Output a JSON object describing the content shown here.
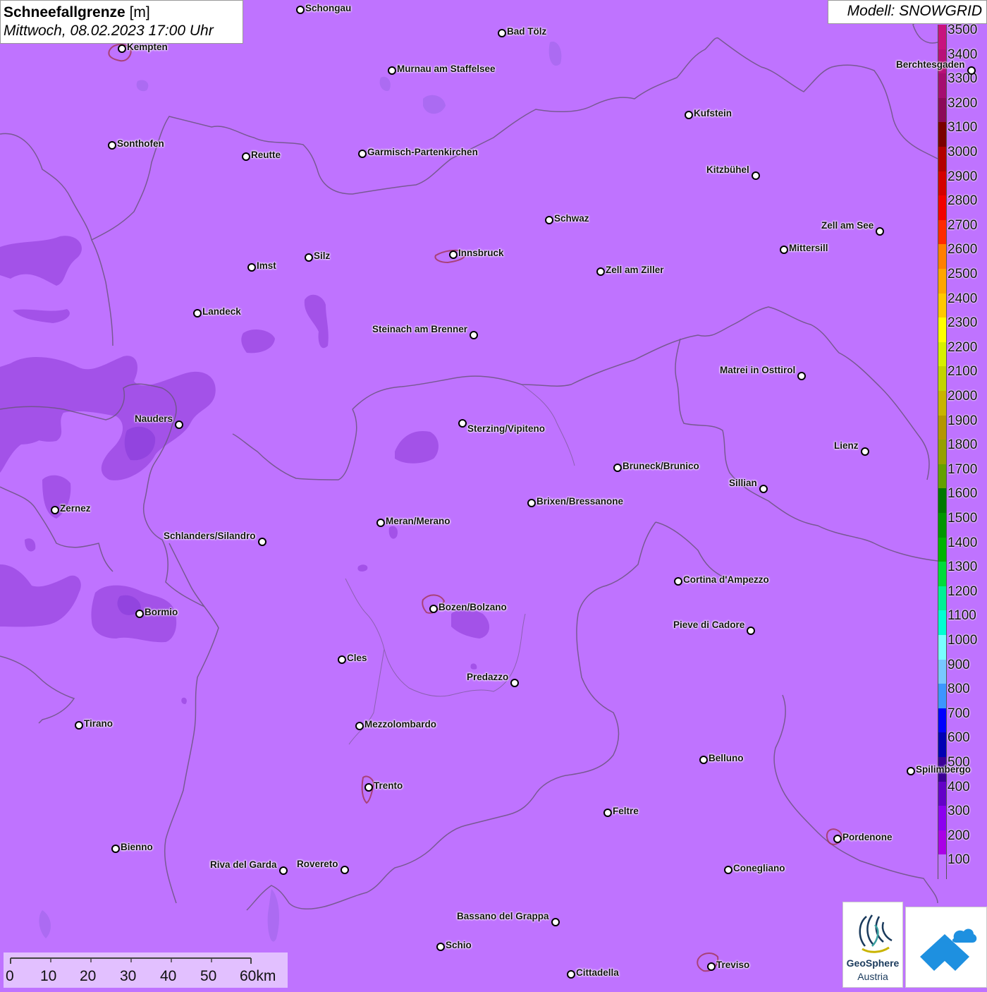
{
  "header": {
    "title_bold": "Schneefallgrenze",
    "title_unit": "[m]",
    "datetime": "Mittwoch, 08.02.2023 17:00 Uhr"
  },
  "model": {
    "label": "Modell: SNOWGRID"
  },
  "legend": {
    "unit": "m",
    "items": [
      {
        "label": "3500",
        "color": "#c8137e"
      },
      {
        "label": "3400",
        "color": "#b81078"
      },
      {
        "label": "3300",
        "color": "#a50d70"
      },
      {
        "label": "3200",
        "color": "#8c0a58"
      },
      {
        "label": "3100",
        "color": "#7a0000"
      },
      {
        "label": "3000",
        "color": "#b30000"
      },
      {
        "label": "2900",
        "color": "#d40000"
      },
      {
        "label": "2800",
        "color": "#f20000"
      },
      {
        "label": "2700",
        "color": "#ff2a00"
      },
      {
        "label": "2600",
        "color": "#ff7f00"
      },
      {
        "label": "2500",
        "color": "#ffa500"
      },
      {
        "label": "2400",
        "color": "#ffc800"
      },
      {
        "label": "2300",
        "color": "#ffff00"
      },
      {
        "label": "2200",
        "color": "#d6f000"
      },
      {
        "label": "2100",
        "color": "#c2d400"
      },
      {
        "label": "2000",
        "color": "#c8b400"
      },
      {
        "label": "1900",
        "color": "#b49600"
      },
      {
        "label": "1800",
        "color": "#96a000"
      },
      {
        "label": "1700",
        "color": "#64a000"
      },
      {
        "label": "1600",
        "color": "#007800"
      },
      {
        "label": "1500",
        "color": "#009600"
      },
      {
        "label": "1400",
        "color": "#00b400"
      },
      {
        "label": "1300",
        "color": "#00dc3c"
      },
      {
        "label": "1200",
        "color": "#00f096"
      },
      {
        "label": "1100",
        "color": "#00ffd2"
      },
      {
        "label": "1000",
        "color": "#78ffff"
      },
      {
        "label": "900",
        "color": "#78c8ff"
      },
      {
        "label": "800",
        "color": "#3c96ff"
      },
      {
        "label": "700",
        "color": "#0000ff"
      },
      {
        "label": "600",
        "color": "#0000b4"
      },
      {
        "label": "500",
        "color": "#3c0096"
      },
      {
        "label": "400",
        "color": "#6400c8"
      },
      {
        "label": "300",
        "color": "#8c00f0"
      },
      {
        "label": "200",
        "color": "#aa00e6"
      },
      {
        "label": "100",
        "color": "#bf73ff"
      }
    ]
  },
  "scale": {
    "labels": [
      "0",
      "10",
      "20",
      "30",
      "40",
      "50",
      "60km"
    ]
  },
  "logos": {
    "geosphere_line1": "GeoSphere",
    "geosphere_line2": "Austria"
  },
  "cities": [
    {
      "name": "Schongau"
    },
    {
      "name": "Bad Tölz"
    },
    {
      "name": "Kempten"
    },
    {
      "name": "Murnau am Staffelsee"
    },
    {
      "name": "Berchtesgaden"
    },
    {
      "name": "Kufstein"
    },
    {
      "name": "Sonthofen"
    },
    {
      "name": "Reutte"
    },
    {
      "name": "Garmisch-Partenkirchen"
    },
    {
      "name": "Kitzbühel"
    },
    {
      "name": "Schwaz"
    },
    {
      "name": "Zell am See"
    },
    {
      "name": "Innsbruck"
    },
    {
      "name": "Mittersill"
    },
    {
      "name": "Imst"
    },
    {
      "name": "Silz"
    },
    {
      "name": "Zell am Ziller"
    },
    {
      "name": "Landeck"
    },
    {
      "name": "Steinach am Brenner"
    },
    {
      "name": "Matrei in Osttirol"
    },
    {
      "name": "Nauders"
    },
    {
      "name": "Sterzing/Vipiteno"
    },
    {
      "name": "Lienz"
    },
    {
      "name": "Bruneck/Brunico"
    },
    {
      "name": "Sillian"
    },
    {
      "name": "Brixen/Bressanone"
    },
    {
      "name": "Zernez"
    },
    {
      "name": "Meran/Merano"
    },
    {
      "name": "Schlanders/Silandro"
    },
    {
      "name": "Cortina d'Ampezzo"
    },
    {
      "name": "Bozen/Bolzano"
    },
    {
      "name": "Bormio"
    },
    {
      "name": "Pieve di Cadore"
    },
    {
      "name": "Cles"
    },
    {
      "name": "Predazzo"
    },
    {
      "name": "Tirano"
    },
    {
      "name": "Mezzolombardo"
    },
    {
      "name": "Belluno"
    },
    {
      "name": "Spilimbergo"
    },
    {
      "name": "Trento"
    },
    {
      "name": "Feltre"
    },
    {
      "name": "Pordenone"
    },
    {
      "name": "Bienno"
    },
    {
      "name": "Riva del Garda"
    },
    {
      "name": "Rovereto"
    },
    {
      "name": "Conegliano"
    },
    {
      "name": "Bassano del Grappa"
    },
    {
      "name": "Schio"
    },
    {
      "name": "Treviso"
    },
    {
      "name": "Cittadella"
    }
  ]
}
